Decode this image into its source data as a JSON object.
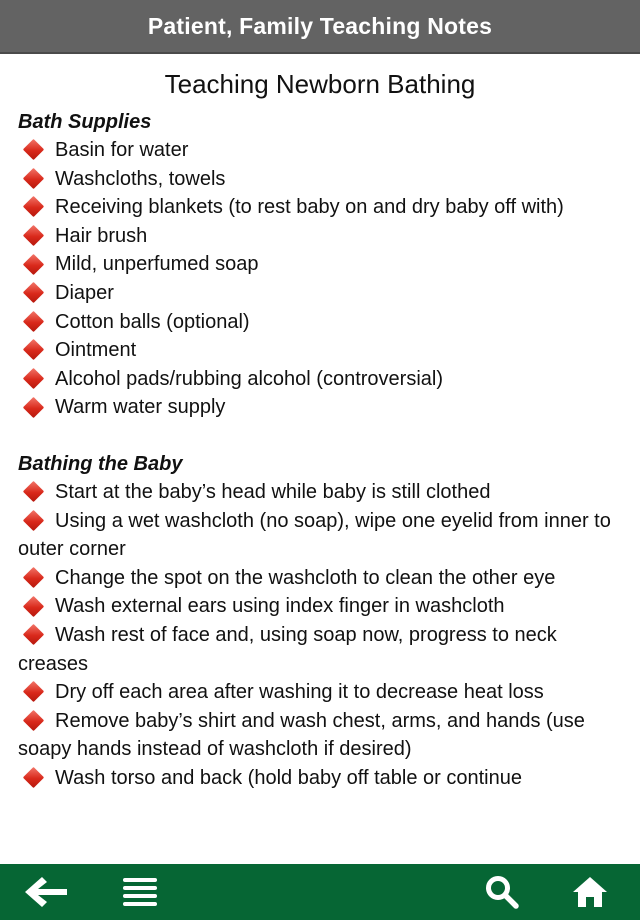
{
  "header": {
    "title": "Patient, Family Teaching Notes"
  },
  "page": {
    "title": "Teaching Newborn Bathing"
  },
  "sections": [
    {
      "heading": "Bath Supplies",
      "items": [
        "Basin for water",
        "Washcloths, towels",
        "Receiving blankets (to rest baby on and dry baby off with)",
        "Hair brush",
        "Mild, unperfumed soap",
        "Diaper",
        "Cotton balls (optional)",
        "Ointment",
        "Alcohol pads/rubbing alcohol (controversial)",
        "Warm water supply"
      ]
    },
    {
      "heading": "Bathing the Baby",
      "items": [
        "Start at the baby’s head while baby is still clothed",
        "Using a wet washcloth (no soap), wipe one eyelid from inner to outer corner",
        "Change the spot on the washcloth to clean the other eye",
        "Wash external ears using index finger in washcloth",
        "Wash rest of face and, using soap now, progress to neck creases",
        "Dry off each area after washing it to decrease heat loss",
        "Remove baby’s shirt and wash chest, arms, and hands (use soapy hands instead of washcloth if desired)",
        "Wash torso and back (hold baby off table or continue"
      ]
    }
  ],
  "toolbar": {
    "back_icon": "arrow-left-icon",
    "menu_icon": "list-menu-icon",
    "search_icon": "search-icon",
    "home_icon": "home-icon"
  },
  "colors": {
    "header_bg": "#636363",
    "toolbar_bg": "#066634",
    "bullet": "#d9291b"
  }
}
